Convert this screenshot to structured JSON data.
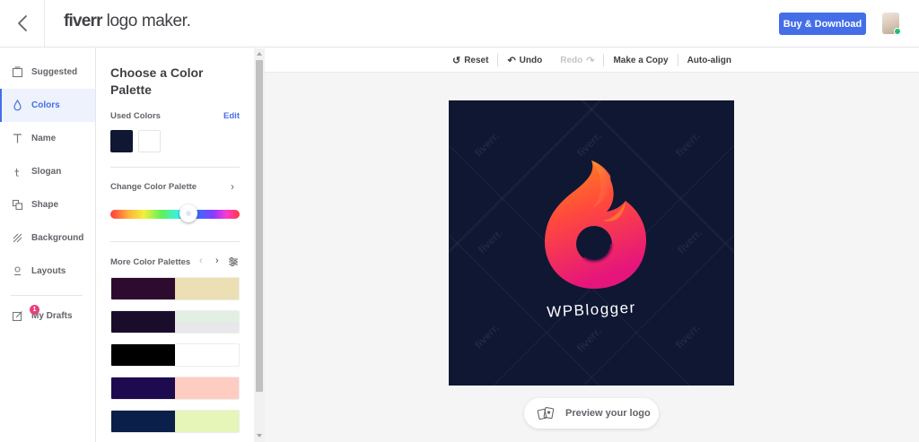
{
  "header": {
    "brand_bold": "fiverr",
    "brand_rest": "logo maker.",
    "buy_button": "Buy & Download"
  },
  "nav": {
    "items": [
      {
        "label": "Suggested",
        "icon": "suggested-icon"
      },
      {
        "label": "Colors",
        "icon": "drop-icon",
        "active": true
      },
      {
        "label": "Name",
        "icon": "text-icon"
      },
      {
        "label": "Slogan",
        "icon": "slogan-icon"
      },
      {
        "label": "Shape",
        "icon": "shape-icon"
      },
      {
        "label": "Background",
        "icon": "background-icon"
      },
      {
        "label": "Layouts",
        "icon": "layouts-icon"
      }
    ],
    "drafts": {
      "label": "My Drafts",
      "badge": "1",
      "icon": "drafts-icon"
    }
  },
  "panel": {
    "title": "Choose a Color Palette",
    "used_colors_label": "Used Colors",
    "edit_label": "Edit",
    "used_colors": [
      "#0f1733",
      "#ffffff"
    ],
    "change_palette_label": "Change Color Palette",
    "hue_level": 0.59,
    "more_palettes_label": "More Color Palettes",
    "palettes": [
      [
        "#2e0a2e",
        "#ecdfb3"
      ],
      [
        "#1a0d2b",
        "#e6efe8"
      ],
      [
        "#000000",
        "#ffffff"
      ],
      [
        "#1e0b4f",
        "#ffccc2"
      ],
      [
        "#0a1f4a",
        "#e6f5b8"
      ]
    ]
  },
  "toolbar": {
    "reset": "Reset",
    "undo": "Undo",
    "redo": "Redo",
    "make_copy": "Make a Copy",
    "auto_align": "Auto-align"
  },
  "canvas": {
    "background": "#0f1733",
    "logo_name": "WPBlogger",
    "watermark": "fiverr."
  },
  "preview_button": "Preview your logo",
  "colors": {
    "accent": "#446ee7",
    "badge": "#e8417a",
    "gradient_start": "#ff7a1a",
    "gradient_end": "#e8177a"
  }
}
